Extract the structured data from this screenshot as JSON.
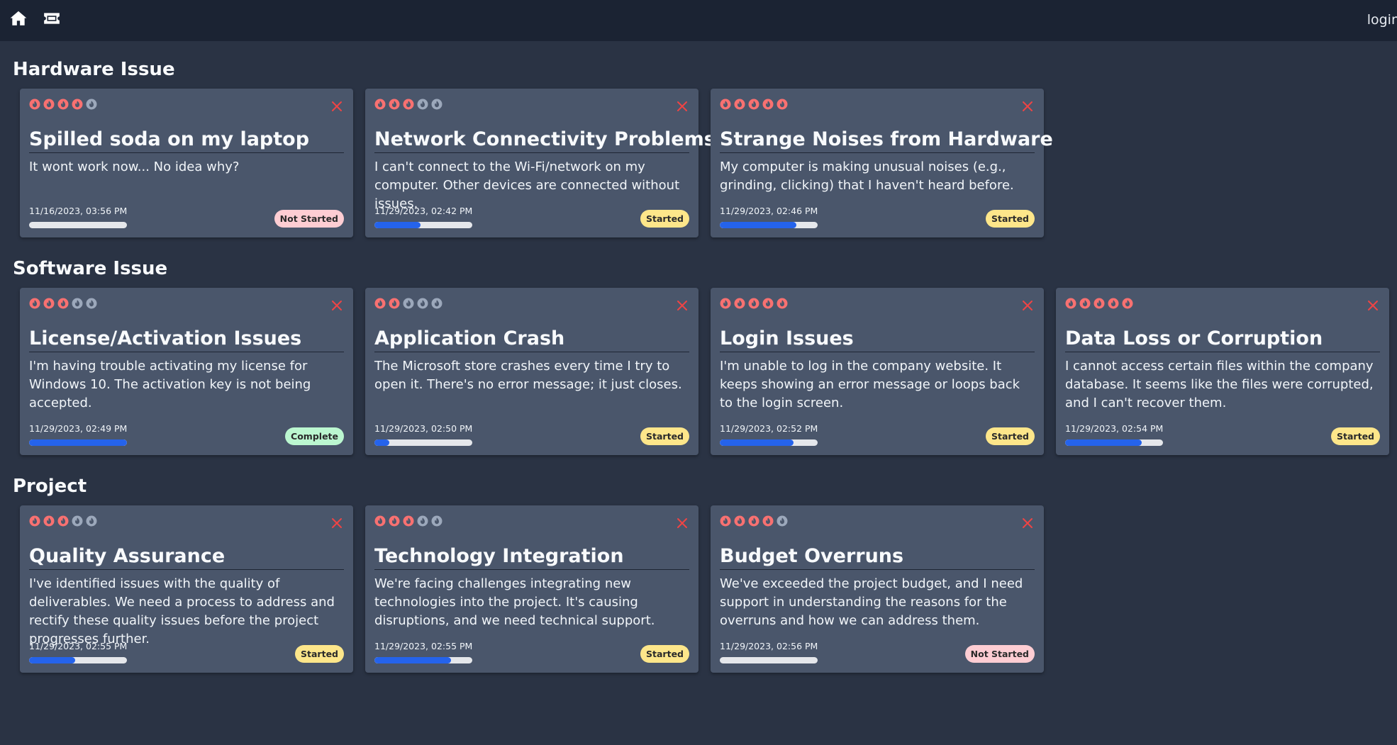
{
  "header": {
    "home_icon": "home-icon",
    "tickets_icon": "ticket-icon",
    "login_label": "login"
  },
  "colors": {
    "page_bg": "#2a3344",
    "topbar_bg": "#1b2333",
    "card_bg": "#4a566b",
    "flame_active": "#f87171",
    "flame_inactive": "#9ca8bb",
    "progress_fill": "#2563eb",
    "progress_track": "#e5e7eb",
    "status_not_started": "#fecdd3",
    "status_started": "#fde68a",
    "status_complete": "#bbf7d0",
    "close_icon": "#ef4444"
  },
  "sections": [
    {
      "title": "Hardware Issue",
      "cards": [
        {
          "title": "Spilled soda on my laptop",
          "description": "It wont work now... No idea why?",
          "date": "11/16/2023, 03:56 PM",
          "priority": 4,
          "progress": 0,
          "status": "Not Started"
        },
        {
          "title": "Network Connectivity Problems",
          "description": "I can't connect to the Wi-Fi/network on my computer. Other devices are connected without issues.",
          "date": "11/29/2023, 02:42 PM",
          "priority": 3,
          "progress": 47,
          "status": "Started"
        },
        {
          "title": "Strange Noises from Hardware",
          "description": "My computer is making unusual noises (e.g., grinding, clicking) that I haven't heard before.",
          "date": "11/29/2023, 02:46 PM",
          "priority": 5,
          "progress": 78,
          "status": "Started"
        }
      ]
    },
    {
      "title": "Software Issue",
      "cards": [
        {
          "title": "License/Activation Issues",
          "description": "I'm having trouble activating my license for Windows 10. The activation key is not being accepted.",
          "date": "11/29/2023, 02:49 PM",
          "priority": 3,
          "progress": 100,
          "status": "Complete"
        },
        {
          "title": "Application Crash",
          "description": "The Microsoft store crashes every time I try to open it. There's no error message; it just closes.",
          "date": "11/29/2023, 02:50 PM",
          "priority": 2,
          "progress": 15,
          "status": "Started"
        },
        {
          "title": "Login Issues",
          "description": "I'm unable to log in the company website. It keeps showing an error message or loops back to the login screen.",
          "date": "11/29/2023, 02:52 PM",
          "priority": 5,
          "progress": 75,
          "status": "Started"
        },
        {
          "title": "Data Loss or Corruption",
          "description": "I cannot access certain files within the company database. It seems like the files were corrupted, and I can't recover them.",
          "date": "11/29/2023, 02:54 PM",
          "priority": 5,
          "progress": 78,
          "status": "Started"
        }
      ]
    },
    {
      "title": "Project",
      "cards": [
        {
          "title": "Quality Assurance",
          "description": "I've identified issues with the quality of deliverables. We need a process to address and rectify these quality issues before the project progresses further.",
          "date": "11/29/2023, 02:55 PM",
          "priority": 3,
          "progress": 47,
          "status": "Started"
        },
        {
          "title": "Technology Integration",
          "description": "We're facing challenges integrating new technologies into the project. It's causing disruptions, and we need technical support.",
          "date": "11/29/2023, 02:55 PM",
          "priority": 3,
          "progress": 78,
          "status": "Started"
        },
        {
          "title": "Budget Overruns",
          "description": "We've exceeded the project budget, and I need support in understanding the reasons for the overruns and how we can address them.",
          "date": "11/29/2023, 02:56 PM",
          "priority": 4,
          "progress": 0,
          "status": "Not Started"
        }
      ]
    }
  ]
}
